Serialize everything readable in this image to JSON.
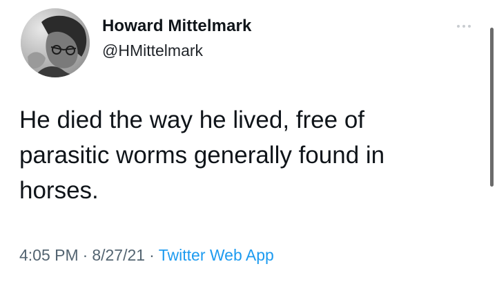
{
  "tweet": {
    "author": {
      "name": "Howard Mittelmark",
      "handle": "@HMittelmark",
      "avatar_icon": "profile-photo"
    },
    "more_icon": "more-options-icon",
    "text_lines": [
      "He died the way he lived, free of",
      "parasitic worms generally found in",
      "horses."
    ],
    "meta": {
      "time": "4:05 PM",
      "separator": "·",
      "date": "8/27/21",
      "source": "Twitter Web App"
    },
    "colors": {
      "text": "#0f1419",
      "meta": "#536471",
      "source_link": "#1d9bf0"
    }
  }
}
